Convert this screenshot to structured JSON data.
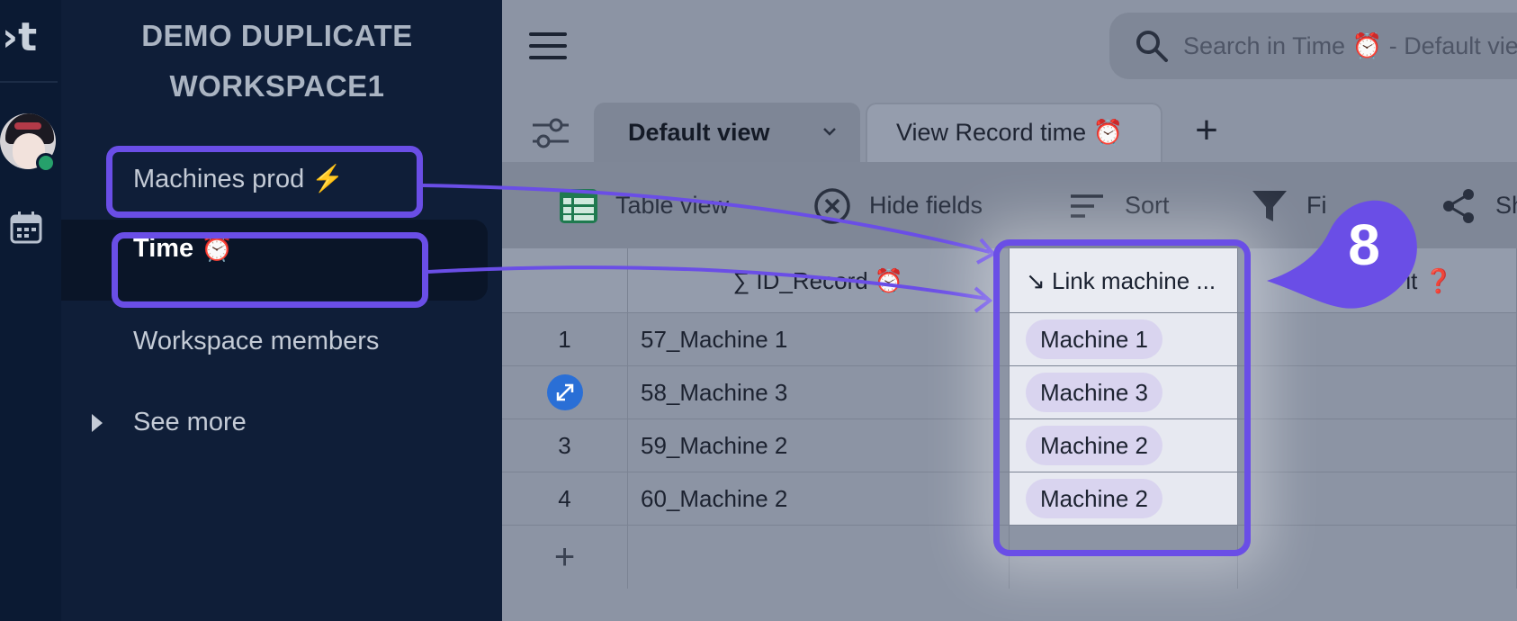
{
  "workspace": {
    "title": "DEMO DUPLICATE WORKSPACE1"
  },
  "rail": {
    "logo_text": "›t",
    "icons": [
      "logo-icon",
      "avatar",
      "calendar-icon"
    ]
  },
  "sidebar": {
    "items": [
      {
        "label": "Machines prod ⚡"
      },
      {
        "label": "Time ⏰"
      },
      {
        "label": "Workspace members"
      },
      {
        "label": "See more"
      }
    ]
  },
  "search": {
    "placeholder": "Search in Time ⏰ - Default view"
  },
  "tabs": [
    {
      "label": "Default view"
    },
    {
      "label": "View Record time ⏰"
    }
  ],
  "toolbar": {
    "table_view": "Table view",
    "hide_fields": "Hide fields",
    "sort": "Sort",
    "filter": "Fi",
    "share": "Sh"
  },
  "grid": {
    "headers": {
      "id": "∑ ID_Record ⏰",
      "link": "↘ Link machine ...",
      "third": "it ❓"
    },
    "rows": [
      {
        "num": "1",
        "id": "57_Machine 1",
        "link": "Machine 1"
      },
      {
        "num": "",
        "id": "58_Machine 3",
        "link": "Machine 3"
      },
      {
        "num": "3",
        "id": "59_Machine 2",
        "link": "Machine 2"
      },
      {
        "num": "4",
        "id": "60_Machine 2",
        "link": "Machine 2"
      }
    ],
    "add_row": "+"
  },
  "annotation": {
    "step_number": "8",
    "accent_color": "#6a4ee6"
  }
}
